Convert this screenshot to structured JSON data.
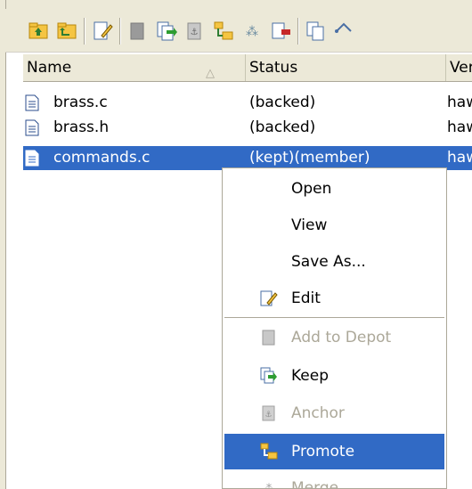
{
  "toolbar": {
    "buttons": [
      {
        "icon": "folder-up-icon"
      },
      {
        "icon": "folder-parent-icon"
      },
      {
        "icon": "edit-document-icon"
      },
      {
        "icon": "add-to-depot-icon"
      },
      {
        "icon": "keep-icon"
      },
      {
        "icon": "anchor-icon"
      },
      {
        "icon": "promote-icon"
      },
      {
        "icon": "merge-icon"
      },
      {
        "icon": "defunct-icon"
      },
      {
        "icon": "copy-icon"
      },
      {
        "icon": "diff-icon"
      }
    ]
  },
  "columns": {
    "name": "Name",
    "status": "Status",
    "version": "Ver"
  },
  "files": [
    {
      "name": "brass.c",
      "status": "(backed)",
      "version": "haw",
      "selected": false
    },
    {
      "name": "brass.h",
      "status": "(backed)",
      "version": "haw",
      "selected": false
    },
    {
      "name": "commands.c",
      "status": "(kept)(member)",
      "version": "haw",
      "selected": true
    }
  ],
  "context_menu": {
    "items": [
      {
        "label": "Open",
        "icon": null,
        "disabled": false,
        "highlighted": false
      },
      {
        "label": "View",
        "icon": null,
        "disabled": false,
        "highlighted": false
      },
      {
        "label": "Save As...",
        "icon": null,
        "disabled": false,
        "highlighted": false
      },
      {
        "label": "Edit",
        "icon": "edit-icon",
        "disabled": false,
        "highlighted": false
      },
      {
        "label": "Add to Depot",
        "icon": "add-to-depot-icon",
        "disabled": true,
        "highlighted": false
      },
      {
        "label": "Keep",
        "icon": "keep-icon",
        "disabled": false,
        "highlighted": false
      },
      {
        "label": "Anchor",
        "icon": "anchor-icon",
        "disabled": true,
        "highlighted": false
      },
      {
        "label": "Promote",
        "icon": "promote-icon",
        "disabled": false,
        "highlighted": true
      },
      {
        "label": "Merge",
        "icon": "merge-icon",
        "disabled": true,
        "highlighted": false
      }
    ]
  },
  "colors": {
    "selection": "#316ac5",
    "chrome": "#ece9d8",
    "disabled_text": "#aca899"
  }
}
